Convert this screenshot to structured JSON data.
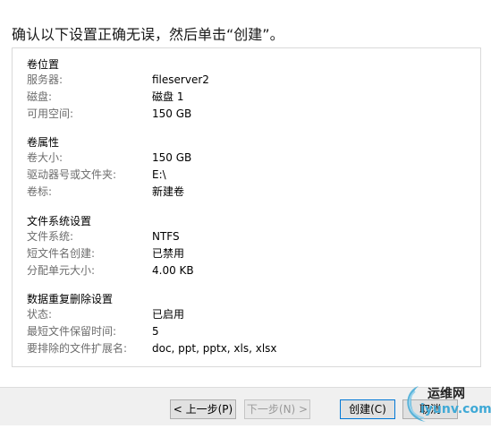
{
  "heading": "确认以下设置正确无误，然后单击“创建”。",
  "sections": [
    {
      "title": "卷位置",
      "rows": [
        {
          "label": "服务器:",
          "value": "fileserver2"
        },
        {
          "label": "磁盘:",
          "value": "磁盘 1"
        },
        {
          "label": "可用空间:",
          "value": "150 GB"
        }
      ]
    },
    {
      "title": "卷属性",
      "rows": [
        {
          "label": "卷大小:",
          "value": "150 GB"
        },
        {
          "label": "驱动器号或文件夹:",
          "value": "E:\\"
        },
        {
          "label": "卷标:",
          "value": "新建卷"
        }
      ]
    },
    {
      "title": "文件系统设置",
      "rows": [
        {
          "label": "文件系统:",
          "value": "NTFS"
        },
        {
          "label": "短文件名创建:",
          "value": "已禁用"
        },
        {
          "label": "分配单元大小:",
          "value": "4.00 KB"
        }
      ]
    },
    {
      "title": "数据重复删除设置",
      "rows": [
        {
          "label": "状态:",
          "value": "已启用"
        },
        {
          "label": "最短文件保留时间:",
          "value": "5"
        },
        {
          "label": "要排除的文件扩展名:",
          "value": "doc, ppt, pptx, xls, xlsx"
        }
      ]
    }
  ],
  "buttons": {
    "prev": "< 上一步(P)",
    "next": "下一步(N) >",
    "create": "创建(C)",
    "cancel": "取消"
  },
  "watermark": {
    "text_cn": "运维网",
    "text_en": "iyunv.com",
    "color": "#3fa9d6"
  }
}
